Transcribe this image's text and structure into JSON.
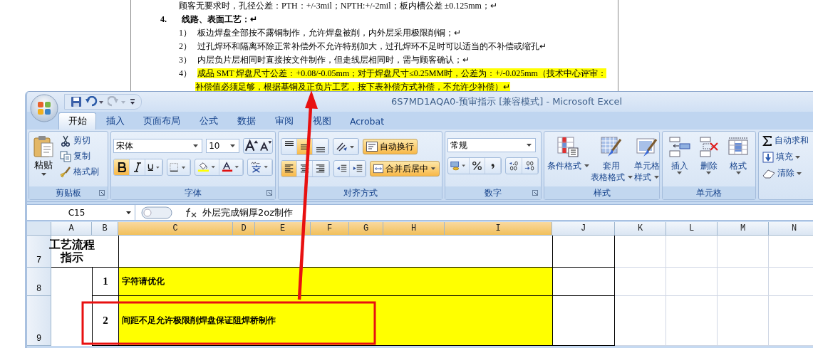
{
  "document": {
    "lines": [
      {
        "kind": "text",
        "text": "顾客无要求时，孔径公差：PTH：+/-3mil；NPTH:+/-2mil；板内槽公差 ±0.125mm；↵",
        "highlighted": false
      },
      {
        "kind": "heading",
        "number": "4.",
        "text": "线路、表面工艺：↵",
        "highlighted": false
      },
      {
        "kind": "item",
        "number": "1）",
        "text": "板边焊盘全部按不露铜制作，允许焊盘被削，内外层采用极限削铜；↵",
        "highlighted": false
      },
      {
        "kind": "item",
        "number": "2）",
        "text": "过孔焊环和隔离环除正常补偿外不允许特别加大，过孔焊环不足时可以适当的不补偿或缩孔↵",
        "highlighted": false
      },
      {
        "kind": "item",
        "number": "3）",
        "text": "内层负片层相同时直接按文件制作，但走线层相同时，需与顾客确认；↵",
        "highlighted": false
      },
      {
        "kind": "item",
        "number": "4）",
        "text": "成品 SMT 焊盘尺寸公差：+0.08/-0.05mm；对于焊盘尺寸≤0.25MM时，公差为：+/-0.025mm（技术中心评审：",
        "highlighted": true
      },
      {
        "kind": "continuation",
        "text": "补偿值必须足够，根据基铜及正负片工艺，按下表补偿方式补偿，不允许少补偿）↵",
        "highlighted": true
      }
    ]
  },
  "excel": {
    "title": "6S7MD1AQA0-预审指示  [兼容模式]  -  Microsoft Excel",
    "tabs": [
      {
        "label": "开始",
        "selected": true
      },
      {
        "label": "插入",
        "selected": false
      },
      {
        "label": "页面布局",
        "selected": false
      },
      {
        "label": "公式",
        "selected": false
      },
      {
        "label": "数据",
        "selected": false
      },
      {
        "label": "审阅",
        "selected": false
      },
      {
        "label": "视图",
        "selected": false
      },
      {
        "label": "Acrobat",
        "selected": false
      }
    ],
    "ribbon": {
      "clipboard": {
        "label": "剪贴板",
        "paste": "粘贴",
        "items": [
          "剪切",
          "复制",
          "格式刷"
        ]
      },
      "font": {
        "label": "字体",
        "font": "宋体",
        "size": "10",
        "bold": true,
        "italic": false,
        "underline": false
      },
      "alignment": {
        "label": "对齐方式",
        "valign": [
          false,
          true,
          false
        ],
        "halign": [
          true,
          false,
          false
        ],
        "wrap": {
          "label": "自动换行",
          "selected": true
        },
        "merge": {
          "label": "合并后居中",
          "selected": true
        }
      },
      "number": {
        "label": "数字",
        "format": "常规"
      },
      "styles": {
        "label": "样式",
        "items": [
          [
            "条件格式"
          ],
          [
            "套用",
            "表格格式"
          ],
          [
            "单元格",
            "样式"
          ]
        ]
      },
      "cells": {
        "label": "单元格",
        "items": [
          "插入",
          "删除",
          "格式"
        ]
      },
      "editing": {
        "items": [
          "自动求和",
          "填充",
          "清除"
        ]
      }
    },
    "name_box": "C15",
    "formula": "外层完成铜厚2oz制作",
    "columns": [
      {
        "label": "A",
        "selected": false
      },
      {
        "label": "B",
        "selected": false
      },
      {
        "label": "C",
        "selected": true
      },
      {
        "label": "D",
        "selected": true
      },
      {
        "label": "E",
        "selected": true
      },
      {
        "label": "F",
        "selected": true
      },
      {
        "label": "G",
        "selected": true
      },
      {
        "label": "H",
        "selected": true
      },
      {
        "label": "I",
        "selected": true
      },
      {
        "label": "J",
        "selected": false
      },
      {
        "label": "K",
        "selected": false
      },
      {
        "label": "L",
        "selected": false
      },
      {
        "label": "M",
        "selected": false
      },
      {
        "label": "N",
        "selected": false
      }
    ],
    "rows": [
      {
        "number": "7",
        "title": [
          "工艺流程",
          "指示"
        ]
      },
      {
        "number": "8",
        "index": "1",
        "text": "字符请优化",
        "highlighted": true
      },
      {
        "number": "9",
        "index": "2",
        "text": "间距不足允许极限削焊盘保证阻焊桥制作",
        "highlighted": true
      }
    ]
  }
}
